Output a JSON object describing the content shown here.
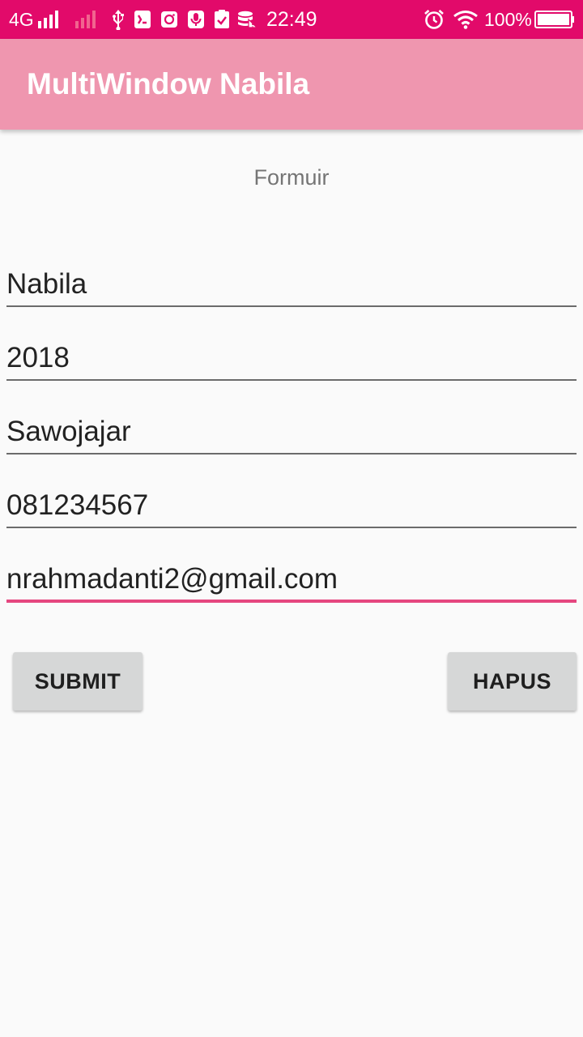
{
  "status_bar": {
    "network": "4G",
    "time": "22:49",
    "battery": "100%",
    "icons": [
      "signal-icon",
      "signal-weak-icon",
      "usb-icon",
      "notification-icon",
      "instagram-icon",
      "mic-icon",
      "checkbox-icon",
      "storage-icon",
      "alarm-icon",
      "wifi-icon",
      "battery-icon"
    ]
  },
  "app_bar": {
    "title": "MultiWindow Nabila"
  },
  "form": {
    "label": "Formuir",
    "fields": [
      {
        "value": "Nabila"
      },
      {
        "value": "2018"
      },
      {
        "value": "Sawojajar"
      },
      {
        "value": "081234567"
      },
      {
        "value": "nrahmadanti2@gmail.com"
      }
    ]
  },
  "buttons": {
    "submit": "SUBMIT",
    "clear": "HAPUS"
  },
  "colors": {
    "status_bar": "#e20a6a",
    "app_bar": "#ef96af",
    "accent": "#e5477f",
    "background": "#fafafa",
    "button": "#d6d7d7"
  }
}
